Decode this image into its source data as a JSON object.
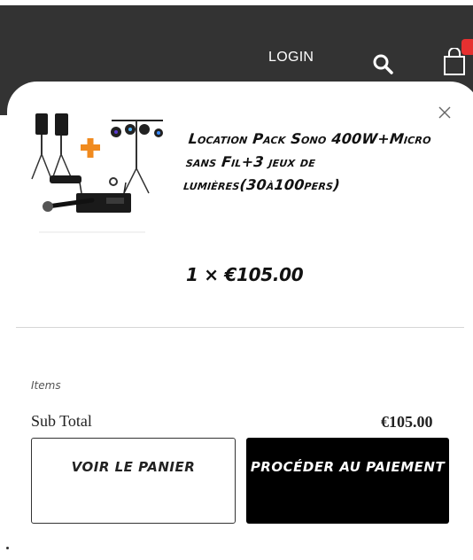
{
  "header": {
    "login_label": "LOGIN",
    "cart_count": "",
    "colors": {
      "bar": "#333333",
      "badge": "#e63030"
    }
  },
  "icons": {
    "search": "search-icon",
    "bag": "shopping-bag-icon",
    "close": "close-icon"
  },
  "cart": {
    "item": {
      "title": "Location Pack Sono 400W+Micro sans Fil+3 jeux de lumières(30à100pers)",
      "quantity_price": "1 × €105.00"
    },
    "items_label": "Items",
    "subtotal_label": "Sub Total",
    "subtotal_value": "€105.00",
    "view_cart_label": "Voir le panier",
    "checkout_label": "Procéder au paiement"
  }
}
